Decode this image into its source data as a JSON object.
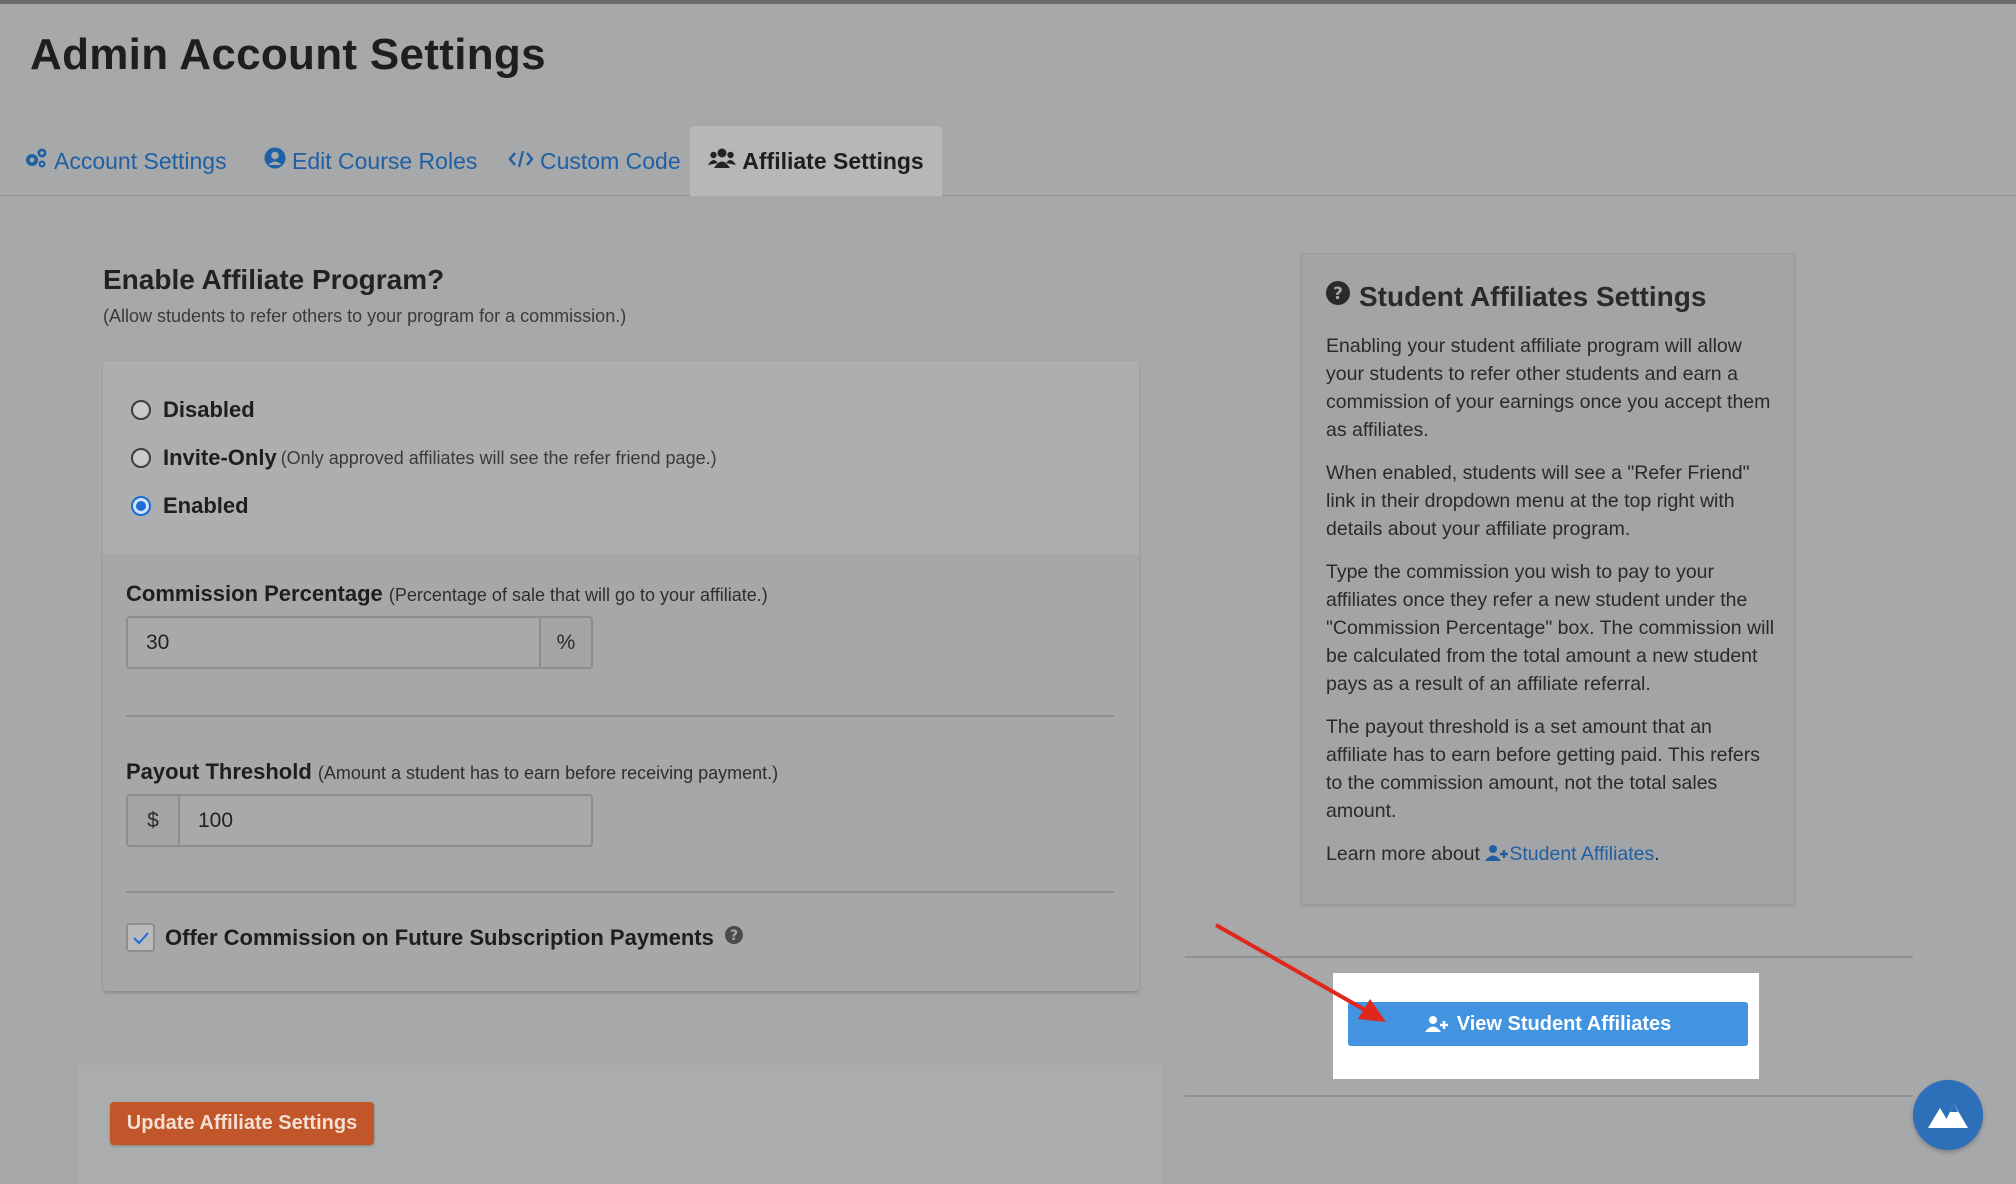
{
  "page": {
    "title": "Admin Account Settings"
  },
  "tabs": [
    {
      "label": "Account Settings",
      "icon": "gears-icon"
    },
    {
      "label": "Edit Course Roles",
      "icon": "user-circle-icon"
    },
    {
      "label": "Custom Code",
      "icon": "code-icon"
    },
    {
      "label": "Affiliate Settings",
      "icon": "users-icon",
      "active": true
    }
  ],
  "affiliate": {
    "heading": "Enable Affiliate Program?",
    "subheading": "(Allow students to refer others to your program for a commission.)",
    "options": [
      {
        "label": "Disabled",
        "note": "",
        "checked": false
      },
      {
        "label": "Invite-Only",
        "note": "(Only approved affiliates will see the refer friend page.)",
        "checked": false
      },
      {
        "label": "Enabled",
        "note": "",
        "checked": true
      }
    ],
    "commission": {
      "label": "Commission Percentage",
      "hint": "(Percentage of sale that will go to your affiliate.)",
      "value": "30",
      "suffix": "%"
    },
    "payout": {
      "label": "Payout Threshold",
      "hint": "(Amount a student has to earn before receiving payment.)",
      "prefix": "$",
      "value": "100"
    },
    "future_payments": {
      "label": "Offer Commission on Future Subscription Payments",
      "checked": true
    },
    "update_button": "Update Affiliate Settings"
  },
  "help": {
    "title": "Student Affiliates Settings",
    "paragraphs": [
      "Enabling your student affiliate program will allow your students to refer other students and earn a commission of your earnings once you accept them as affiliates.",
      "When enabled, students will see a \"Refer Friend\" link in their dropdown menu at the top right with details about your affiliate program.",
      "Type the commission you wish to pay to your affiliates once they refer a new student under the \"Commission Percentage\" box. The commission will be calculated from the total amount a new student pays as a result of an affiliate referral.",
      "The payout threshold is a set amount that an affiliate has to earn before getting paid. This refers to the commission amount, not the total sales amount."
    ],
    "learn_more_prefix": "Learn more about",
    "learn_more_link": "Student Affiliates",
    "learn_more_suffix": "."
  },
  "view_button": "View Student Affiliates",
  "colors": {
    "link": "#1f5fa3",
    "update_button": "#c0562a",
    "view_button": "#4294e0",
    "annotation_arrow": "#e0261d",
    "fab": "#2d6fb8"
  }
}
